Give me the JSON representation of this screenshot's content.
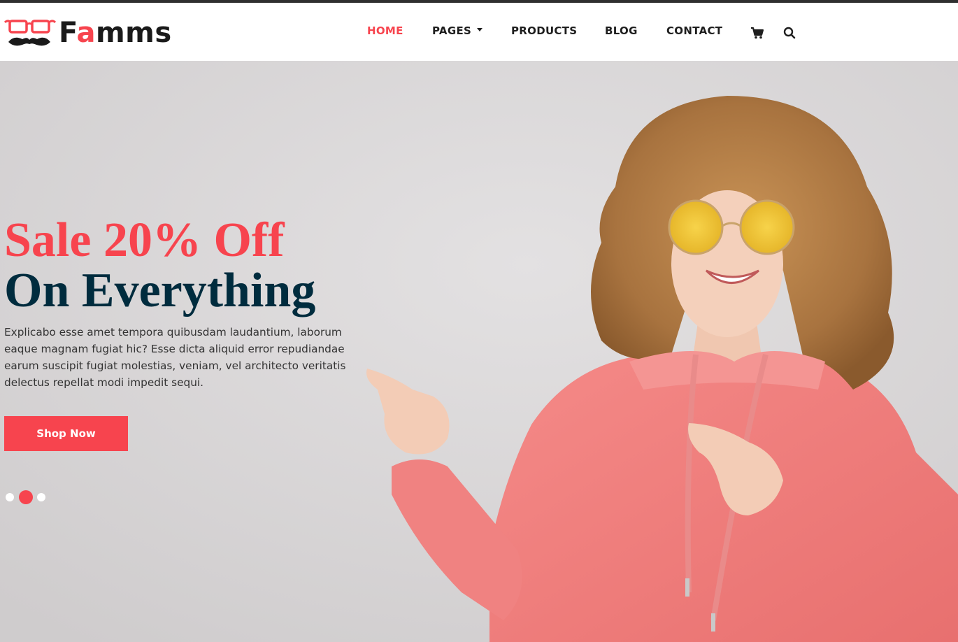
{
  "brand": {
    "name_start": "F",
    "name_accent": "a",
    "name_end": "mms",
    "accent_color": "#f7444e",
    "dark_color": "#002c3e"
  },
  "nav": {
    "home": "HOME",
    "pages": "PAGES",
    "products": "PRODUCTS",
    "blog": "BLOG",
    "contact": "CONTACT",
    "cart_icon": "cart-icon",
    "search_icon": "search-icon"
  },
  "hero": {
    "headline_line1": "Sale 20% Off",
    "headline_line2": "On Everything",
    "description": "Explicabo esse amet tempora quibusdam laudantium, laborum eaque magnam fugiat hic? Esse dicta aliquid error repudiandae earum suscipit fugiat molestias, veniam, vel architecto veritatis delectus repellat modi impedit sequi.",
    "button_label": "Shop Now",
    "slides_total": 3,
    "active_slide": 2
  }
}
